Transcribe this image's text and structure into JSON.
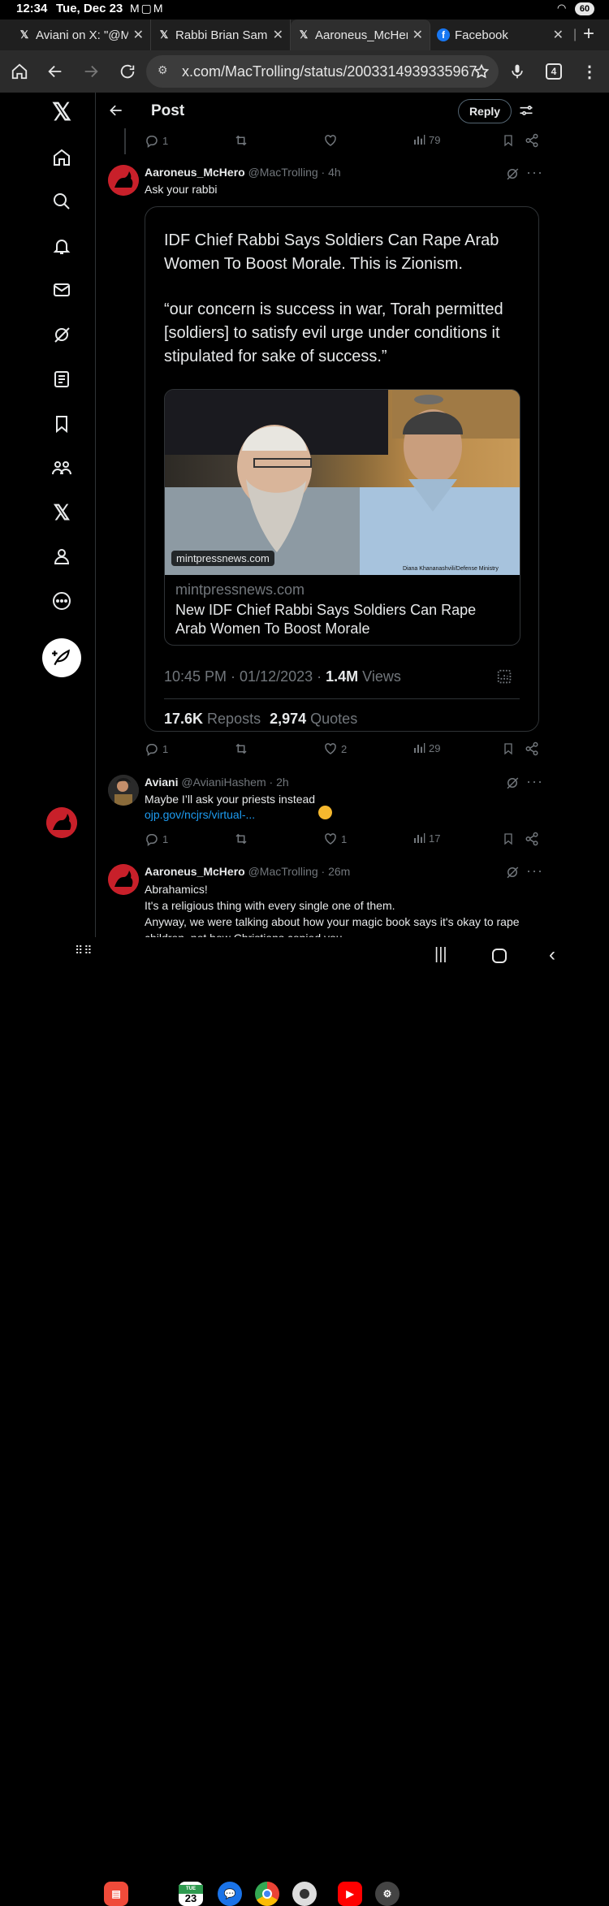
{
  "status_bar": {
    "time": "12:34",
    "date": "Tue, Dec 23",
    "battery": "60"
  },
  "tabs": [
    {
      "label": "Aviani on X: \"@M",
      "favicon": "x-logo"
    },
    {
      "label": "Rabbi Brian Samu",
      "favicon": "x-logo"
    },
    {
      "label": "Aaroneus_McHer",
      "favicon": "x-logo"
    },
    {
      "label": "Facebook",
      "favicon": "facebook-logo"
    }
  ],
  "url": "x.com/MacTrolling/status/2003314939335967",
  "tab_count": "4",
  "header": {
    "title": "Post",
    "reply_button": "Reply"
  },
  "top_actions": {
    "replies": "1",
    "views": "79"
  },
  "post1": {
    "name": "Aaroneus_McHero",
    "handle": "@MacTrolling",
    "time": "· 4h",
    "text": "Ask your rabbi",
    "quote": {
      "line1": "IDF Chief Rabbi Says Soldiers Can Rape Arab Women To Boost Morale. This is Zionism.",
      "line2": "“our concern is success in war, Torah permitted [soldiers] to satisfy evil urge under conditions it stipulated for sake of success.”",
      "image_overlay": "mintpressnews.com",
      "image_credit": "Diana Khananashvili/Defense Ministry",
      "link_domain": "mintpressnews.com",
      "link_title": "New IDF Chief Rabbi Says Soldiers Can Rape Arab Women To Boost Morale",
      "timestamp": "10:45 PM · 01/12/2023 · ",
      "views_count": "1.4M",
      "views_label": " Views",
      "reposts_count": "17.6K",
      "reposts_label": " Reposts",
      "quotes_count": "2,974",
      "quotes_label": " Quotes"
    },
    "replies": "1",
    "likes": "2",
    "views": "29"
  },
  "post2": {
    "name": "Aviani",
    "handle": "@AvianiHashem",
    "time": "· 2h",
    "text": "Maybe I’ll ask your priests instead",
    "emoji": "😏",
    "link": "ojp.gov/ncjrs/virtual-...",
    "replies": "1",
    "likes": "1",
    "views": "17"
  },
  "post3": {
    "name": "Aaroneus_McHero",
    "handle": "@MacTrolling",
    "time": "· 26m",
    "line1": "Abrahamics!",
    "line2": "It's a religious thing with every single one of them.",
    "line3": "Anyway, we were talking about how your magic book says it's okay to rape",
    "line4": "children, not how Christians copied you."
  },
  "dock_calendar": "23",
  "dock_calendar_day": "TUE",
  "colors": {
    "background": "#000000",
    "link": "#1d9bf0",
    "muted": "#71767b",
    "text": "#e7e9ea",
    "avatar": "#c8202a"
  }
}
